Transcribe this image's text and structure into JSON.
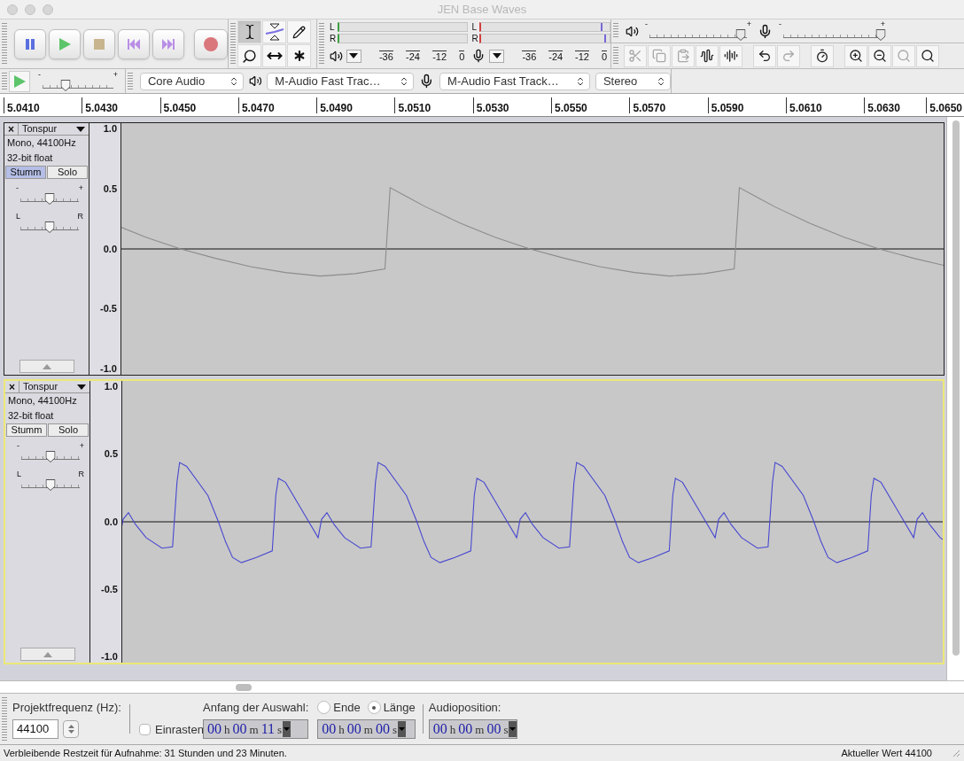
{
  "window": {
    "title": "JEN Base Waves"
  },
  "transport": [
    {
      "kind": "pause"
    },
    {
      "kind": "play"
    },
    {
      "kind": "stop"
    },
    {
      "kind": "skip_start"
    },
    {
      "kind": "skip_end"
    },
    {
      "kind": "record"
    }
  ],
  "tools": [
    {
      "kind": "select",
      "selected": true
    },
    {
      "kind": "envelope",
      "selected": false
    },
    {
      "kind": "draw",
      "selected": false
    },
    {
      "kind": "zoom",
      "selected": false
    },
    {
      "kind": "timeshift",
      "selected": false
    },
    {
      "kind": "multi",
      "selected": false
    }
  ],
  "meters": [
    {
      "kind": "playback",
      "channels": [
        {
          "label": "L"
        },
        {
          "label": "R"
        }
      ],
      "scale": [
        "-36",
        "-24",
        "-12",
        "0"
      ]
    },
    {
      "kind": "recording",
      "channels": [
        {
          "label": "L",
          "level": 0.93
        },
        {
          "label": "R",
          "level": 0.96
        }
      ],
      "scale": [
        "-36",
        "-24",
        "-12",
        "0"
      ]
    }
  ],
  "mixer": [
    {
      "kind": "output",
      "min_label": "-",
      "max_label": "+",
      "level": 0.94
    },
    {
      "kind": "input",
      "min_label": "-",
      "max_label": "+",
      "level": 1.0
    }
  ],
  "edit_groups": [
    [
      {
        "kind": "trim_outside",
        "disabled": true
      },
      {
        "kind": "copy",
        "disabled": true
      },
      {
        "kind": "paste",
        "disabled": true
      },
      {
        "kind": "trim",
        "disabled": false
      },
      {
        "kind": "silence",
        "disabled": false
      }
    ],
    [
      {
        "kind": "undo",
        "disabled": false
      },
      {
        "kind": "redo",
        "disabled": true
      }
    ],
    [
      {
        "kind": "sync",
        "disabled": false
      }
    ],
    [
      {
        "kind": "zoom_in",
        "disabled": false
      },
      {
        "kind": "zoom_out",
        "disabled": false
      },
      {
        "kind": "fit_selection",
        "disabled": true
      },
      {
        "kind": "fit_project",
        "disabled": false
      }
    ]
  ],
  "play_at_speed": {
    "min_label": "-",
    "max_label": "+",
    "level": 0.32
  },
  "devices": [
    {
      "kind": "host",
      "value": "Core Audio"
    },
    {
      "kind": "output",
      "value": "M-Audio Fast Trac…"
    },
    {
      "kind": "input",
      "value": "M-Audio Fast Track…"
    },
    {
      "kind": "channels",
      "value": "Stereo"
    }
  ],
  "ruler": {
    "ticks": [
      "5.0410",
      "5.0430",
      "5.0450",
      "5.0470",
      "5.0490",
      "5.0510",
      "5.0530",
      "5.0550",
      "5.0570",
      "5.0590",
      "5.0610",
      "5.0630",
      "5.0650"
    ]
  },
  "tracks": [
    {
      "close": "×",
      "name": "Tonspur",
      "info": [
        "Mono, 44100Hz",
        "32-bit float"
      ],
      "selected": false,
      "kind": "sawtooth",
      "mute": {
        "label": "Stumm",
        "on": true
      },
      "solo": {
        "label": "Solo",
        "on": false
      },
      "gain": {
        "min_label": "-",
        "max_label": "+",
        "level": 0.5
      },
      "pan": {
        "min_label": "L",
        "max_label": "R",
        "level": 0.5
      },
      "scale": [
        "1.0",
        "0.5",
        "0.0",
        "-0.5",
        "-1.0"
      ]
    },
    {
      "close": "×",
      "name": "Tonspur",
      "info": [
        "Mono, 44100Hz",
        "32-bit float"
      ],
      "selected": true,
      "kind": "complex",
      "mute": {
        "label": "Stumm",
        "on": false
      },
      "solo": {
        "label": "Solo",
        "on": false
      },
      "gain": {
        "min_label": "-",
        "max_label": "+",
        "level": 0.5
      },
      "pan": {
        "min_label": "L",
        "max_label": "R",
        "level": 0.5
      },
      "scale": [
        "1.0",
        "0.5",
        "0.0",
        "-0.5",
        "-1.0"
      ]
    }
  ],
  "selection_bar": {
    "rate_label": "Projektfrequenz (Hz):",
    "rate": "44100",
    "snap": {
      "label": "Einrasten",
      "checked": false
    },
    "start_label": "Anfang der Auswahl:",
    "modes": [
      {
        "label": "Ende",
        "selected": false
      },
      {
        "label": "Länge",
        "selected": true
      }
    ],
    "position_label": "Audioposition:",
    "times": [
      {
        "parts": [
          {
            "value": "00",
            "unit": "h"
          },
          {
            "value": "00",
            "unit": "m"
          },
          {
            "value": "11",
            "unit": "s"
          }
        ]
      },
      {
        "parts": [
          {
            "value": "00",
            "unit": "h"
          },
          {
            "value": "00",
            "unit": "m"
          },
          {
            "value": "00",
            "unit": "s"
          }
        ]
      },
      {
        "parts": [
          {
            "value": "00",
            "unit": "h"
          },
          {
            "value": "00",
            "unit": "m"
          },
          {
            "value": "00",
            "unit": "s"
          }
        ]
      }
    ]
  },
  "status_bar": {
    "message": "Verbleibende Restzeit für Aufnahme: 31 Stunden und 23 Minuten.",
    "value": "Aktueller Wert 44100"
  }
}
